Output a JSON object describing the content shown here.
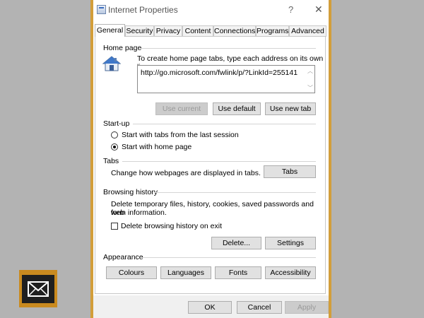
{
  "window": {
    "title": "Internet Properties",
    "help_label": "?",
    "close_label": "✕"
  },
  "tabs": [
    {
      "label": "General",
      "active": true
    },
    {
      "label": "Security"
    },
    {
      "label": "Privacy"
    },
    {
      "label": "Content"
    },
    {
      "label": "Connections"
    },
    {
      "label": "Programs"
    },
    {
      "label": "Advanced"
    }
  ],
  "home_page": {
    "title": "Home page",
    "instruction": "To create home page tabs, type each address on its own line.",
    "url": "http://go.microsoft.com/fwlink/p/?LinkId=255141",
    "use_current": "Use current",
    "use_default": "Use default",
    "use_new_tab": "Use new tab"
  },
  "startup": {
    "title": "Start-up",
    "option_last_session": "Start with tabs from the last session",
    "option_home_page": "Start with home page",
    "selected": "home_page"
  },
  "tabs_section": {
    "title": "Tabs",
    "description": "Change how webpages are displayed in tabs.",
    "button": "Tabs"
  },
  "browsing_history": {
    "title": "Browsing history",
    "description_line1": "Delete temporary files, history, cookies, saved passwords and web",
    "description_line2": "form information.",
    "delete_on_exit": "Delete browsing history on exit",
    "delete_on_exit_checked": false,
    "delete_button": "Delete...",
    "settings_button": "Settings"
  },
  "appearance": {
    "title": "Appearance",
    "colours": "Colours",
    "languages": "Languages",
    "fonts": "Fonts",
    "accessibility": "Accessibility"
  },
  "footer": {
    "ok": "OK",
    "cancel": "Cancel",
    "apply": "Apply"
  },
  "colors": {
    "frame": "#d29e3a",
    "badge": "#c98a1f",
    "background": "#b3b3b3"
  },
  "overlay_icon": "mail-envelope-icon"
}
